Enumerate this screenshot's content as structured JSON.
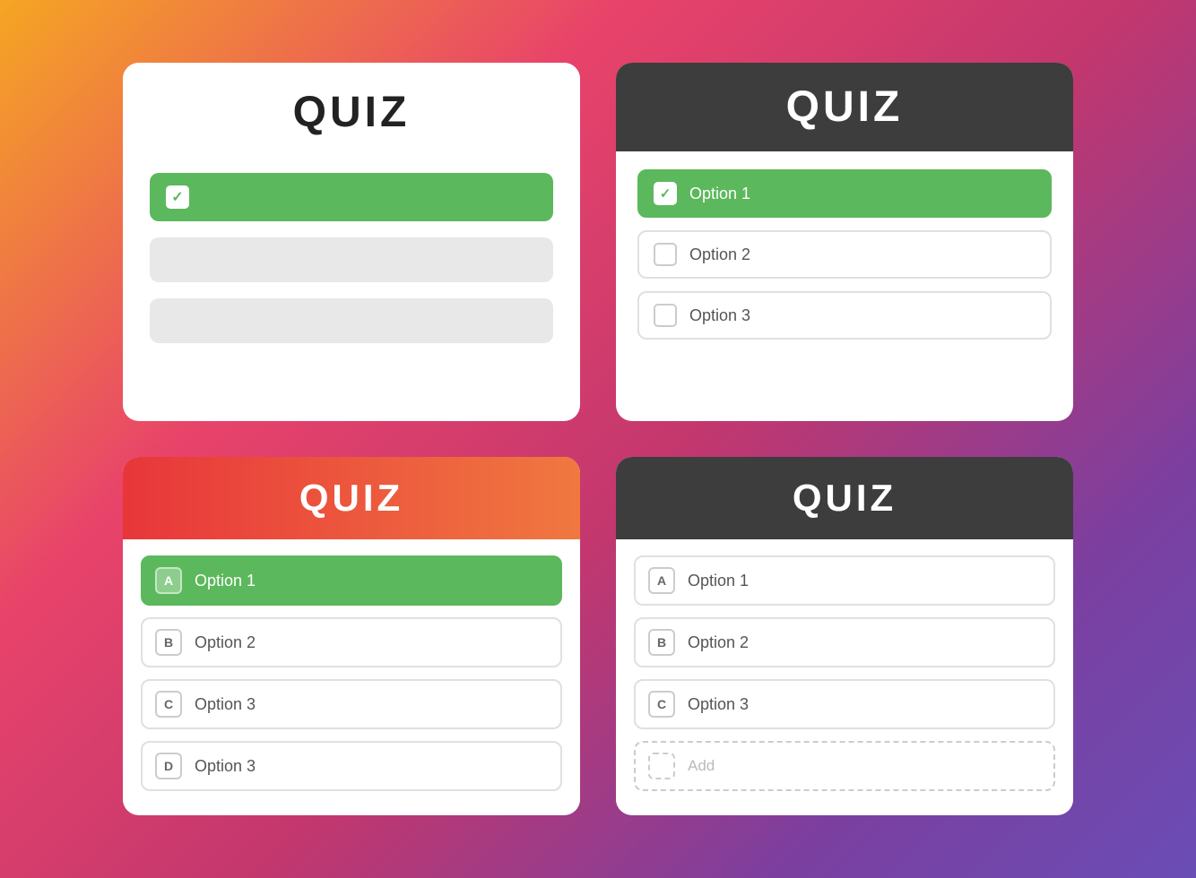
{
  "card1": {
    "title": "QUIZ",
    "options": [
      {
        "selected": true
      },
      {
        "selected": false
      },
      {
        "selected": false
      }
    ]
  },
  "card2": {
    "title": "QUIZ",
    "options": [
      {
        "label": "Option 1",
        "selected": true
      },
      {
        "label": "Option 2",
        "selected": false
      },
      {
        "label": "Option 3",
        "selected": false
      }
    ]
  },
  "card3": {
    "title": "QUIZ",
    "options": [
      {
        "letter": "A",
        "label": "Option 1",
        "selected": true
      },
      {
        "letter": "B",
        "label": "Option 2",
        "selected": false
      },
      {
        "letter": "C",
        "label": "Option 3",
        "selected": false
      },
      {
        "letter": "D",
        "label": "Option 3",
        "selected": false
      }
    ]
  },
  "card4": {
    "title": "QUIZ",
    "options": [
      {
        "letter": "A",
        "label": "Option 1"
      },
      {
        "letter": "B",
        "label": "Option 2"
      },
      {
        "letter": "C",
        "label": "Option 3"
      }
    ],
    "add_label": "Add"
  }
}
